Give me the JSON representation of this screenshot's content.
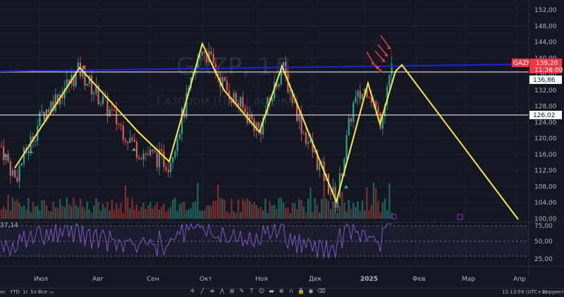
{
  "watermark": {
    "symbol": "GAZP, 1Д",
    "name": "Газпром  (ПАО) ао ыкн."
  },
  "price_axis": {
    "ticks": [
      "152,00",
      "148,00",
      "144,00",
      "140,00",
      "136,00",
      "132,00",
      "128,00",
      "124,00",
      "120,00",
      "116,00",
      "112,00",
      "108,00",
      "104,00",
      "100,00"
    ],
    "ticks_values": [
      152,
      148,
      144,
      140,
      136,
      132,
      128,
      124,
      120,
      116,
      112,
      108,
      104,
      100
    ]
  },
  "tags": {
    "symbol": "GAZP",
    "price": "139,20",
    "countdown": "11:36:00",
    "level_high": "136,86",
    "level_low": "126,02"
  },
  "rsi_axis": {
    "ticks": [
      "75,00",
      "50,00",
      "25,00"
    ],
    "left_label": "37,14"
  },
  "time_axis": {
    "months": [
      "Июл",
      "Авг",
      "Сен",
      "Окт",
      "Ноя",
      "Дек",
      "2025",
      "Фев",
      "Мар",
      "Апр"
    ]
  },
  "bottom_bar": {
    "timeframes": [
      "ес",
      "YTD",
      "1г",
      "5л",
      "Все"
    ],
    "clock": "12:13:59 (UTC+3)",
    "mode": "коррект."
  },
  "colors": {
    "up": "#26a69a",
    "down": "#ef5350",
    "zigzag": "#ffeb3b",
    "blue_line": "#1e22c8",
    "rsi": "#7e57c2",
    "tag_red": "#f23645"
  },
  "chart_data": {
    "type": "candlestick",
    "symbol": "GAZP",
    "timeframe": "1Д",
    "ylim": [
      100,
      154
    ],
    "horizontal_levels": [
      136.86,
      126.02
    ],
    "trend_line": {
      "from": 137.2,
      "to": 139.8
    },
    "zigzag_pattern": [
      {
        "month": "Июн end",
        "price": 111
      },
      {
        "month": "Июл",
        "price": 137
      },
      {
        "month": "Авг end",
        "price": 115
      },
      {
        "month": "Окт",
        "price": 144
      },
      {
        "month": "Окт end",
        "price": 121
      },
      {
        "month": "Ноя",
        "price": 138
      },
      {
        "month": "Дек end",
        "price": 104
      },
      {
        "month": "2025",
        "price": 134
      },
      {
        "month": "2025",
        "price": 124
      },
      {
        "month": "2025",
        "price": 138
      },
      {
        "month": "Янв end",
        "price": 137
      },
      {
        "month": "Апр",
        "price": 100
      }
    ],
    "rsi": {
      "ylim": [
        0,
        100
      ],
      "levels": [
        75,
        50,
        25
      ],
      "last": 70
    }
  }
}
